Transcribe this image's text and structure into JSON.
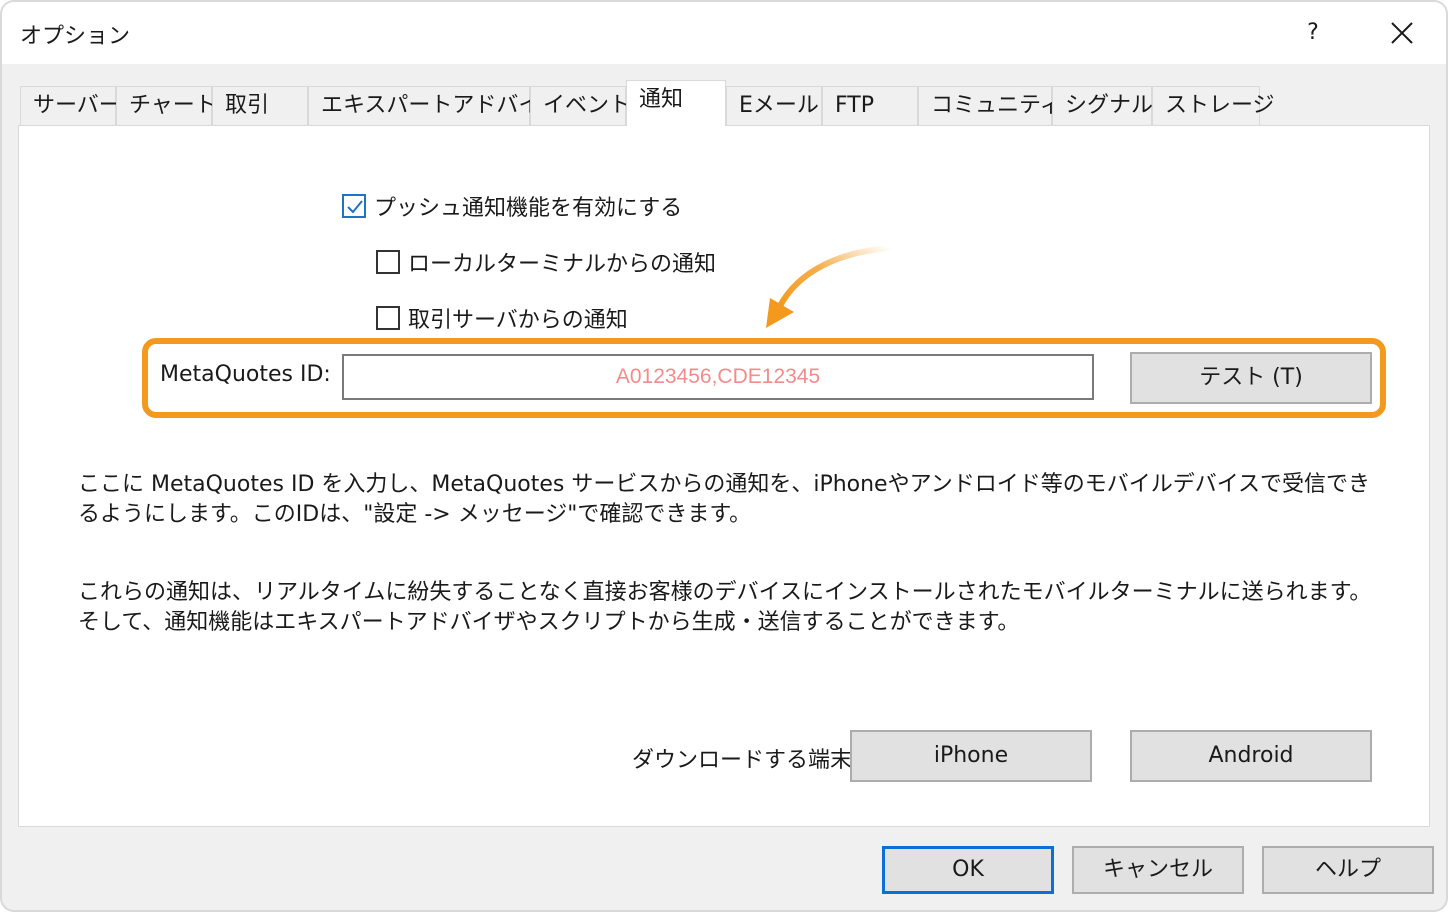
{
  "window": {
    "title": "オプション",
    "help_label": "?"
  },
  "tabs": [
    {
      "label": "サーバー"
    },
    {
      "label": "チャート"
    },
    {
      "label": "取引"
    },
    {
      "label": "エキスパートアドバイザ"
    },
    {
      "label": "イベント"
    },
    {
      "label": "通知"
    },
    {
      "label": "Eメール"
    },
    {
      "label": "FTP"
    },
    {
      "label": "コミュニティー"
    },
    {
      "label": "シグナル"
    },
    {
      "label": "ストレージ"
    }
  ],
  "active_tab": "通知",
  "notifications": {
    "enable_push": {
      "label": "プッシュ通知機能を有効にする",
      "checked": true
    },
    "from_local_terminal": {
      "label": "ローカルターミナルからの通知",
      "checked": false
    },
    "from_trade_server": {
      "label": "取引サーバからの通知",
      "checked": false
    },
    "metaquotes_id_label": "MetaQuotes ID:",
    "metaquotes_id_value": "A0123456,CDE12345",
    "test_button": "テスト (T)",
    "description_1": "ここに MetaQuotes ID を入力し、MetaQuotes サービスからの通知を、iPhoneやアンドロイド等のモバイルデバイスで受信できるようにします。このIDは、\"設定 -> メッセージ\"で確認できます。",
    "description_2": "これらの通知は、リアルタイムに紛失することなく直接お客様のデバイスにインストールされたモバイルターミナルに送られます。そして、通知機能はエキスパートアドバイザやスクリプトから生成・送信することができます。",
    "download_label": "ダウンロードする端末:",
    "iphone_button": "iPhone",
    "android_button": "Android"
  },
  "footer": {
    "ok": "OK",
    "cancel": "キャンセル",
    "help": "ヘルプ"
  },
  "colors": {
    "highlight": "#f39a1e",
    "id_text": "#f28c8c",
    "default_button_border": "#0a6fd6"
  }
}
